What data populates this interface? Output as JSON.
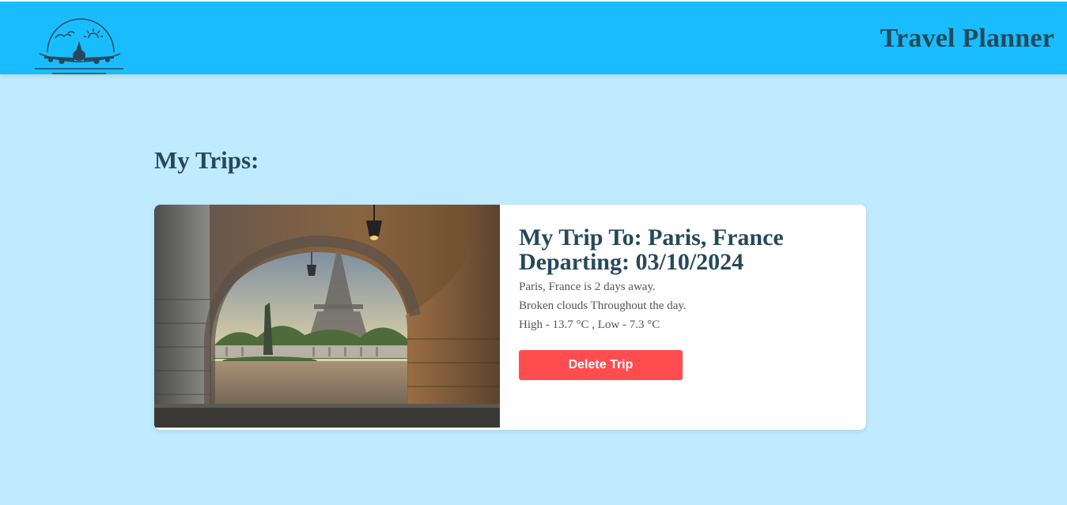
{
  "header": {
    "title": "Travel Planner",
    "logo_icon": "airplane-sunset-logo-icon"
  },
  "trips_section": {
    "title": "My Trips:"
  },
  "trip": {
    "heading_destination": "My Trip To: Paris, France",
    "heading_departing": "Departing: 03/10/2024",
    "countdown": "Paris, France is 2 days away.",
    "weather_summary": "Broken clouds Throughout the day.",
    "temperature": "High - 13.7 °C , Low - 7.3 °C",
    "delete_label": "Delete Trip",
    "image_subject": "eiffel-tower-through-arch-photo"
  },
  "colors": {
    "header_bg": "#19bdff",
    "page_bg": "#c0eafd",
    "title_text": "#25495a",
    "delete_button": "#ff4d4f"
  }
}
